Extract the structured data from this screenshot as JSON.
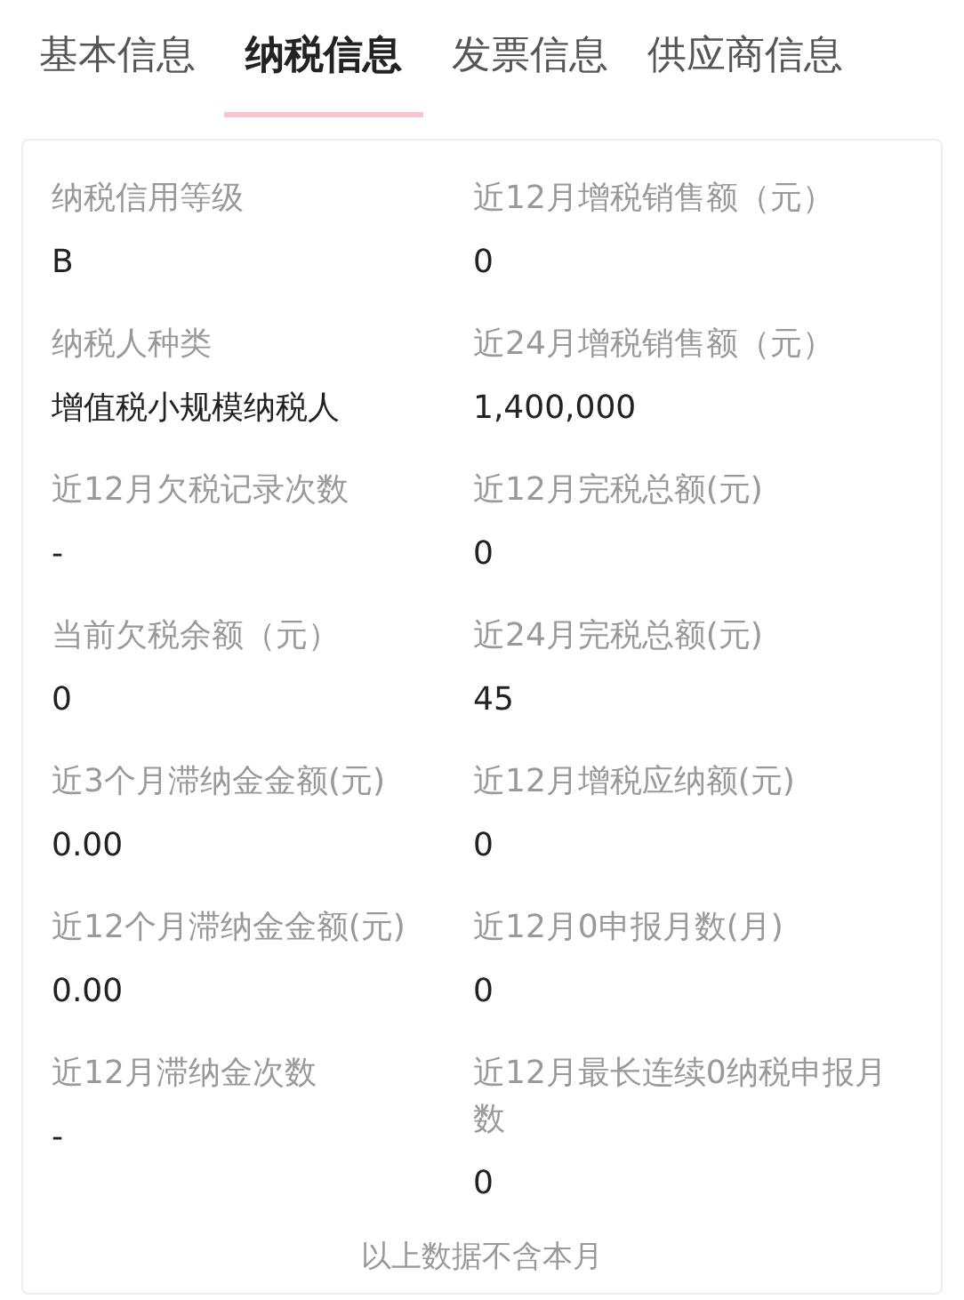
{
  "tabs": [
    {
      "label": "基本信息",
      "selected": false
    },
    {
      "label": "纳税信息",
      "selected": true
    },
    {
      "label": "发票信息",
      "selected": false
    },
    {
      "label": "供应商信息",
      "selected": false
    }
  ],
  "fields": [
    {
      "label": "纳税信用等级",
      "value": "B"
    },
    {
      "label": "近12月增税销售额（元）",
      "value": "0"
    },
    {
      "label": "纳税人种类",
      "value": "增值税小规模纳税人"
    },
    {
      "label": "近24月增税销售额（元）",
      "value": "1,400,000"
    },
    {
      "label": "近12月欠税记录次数",
      "value": "-"
    },
    {
      "label": "近12月完税总额(元)",
      "value": "0"
    },
    {
      "label": "当前欠税余额（元）",
      "value": "0"
    },
    {
      "label": "近24月完税总额(元)",
      "value": "45"
    },
    {
      "label": "近3个月滞纳金金额(元)",
      "value": "0.00"
    },
    {
      "label": "近12月增税应纳额(元)",
      "value": "0"
    },
    {
      "label": "近12个月滞纳金金额(元)",
      "value": "0.00"
    },
    {
      "label": "近12月0申报月数(月)",
      "value": "0"
    },
    {
      "label": "近12月滞纳金次数",
      "value": "-"
    },
    {
      "label": "近12月最长连续0纳税申报月数",
      "value": "0"
    }
  ],
  "note": "以上数据不含本月"
}
